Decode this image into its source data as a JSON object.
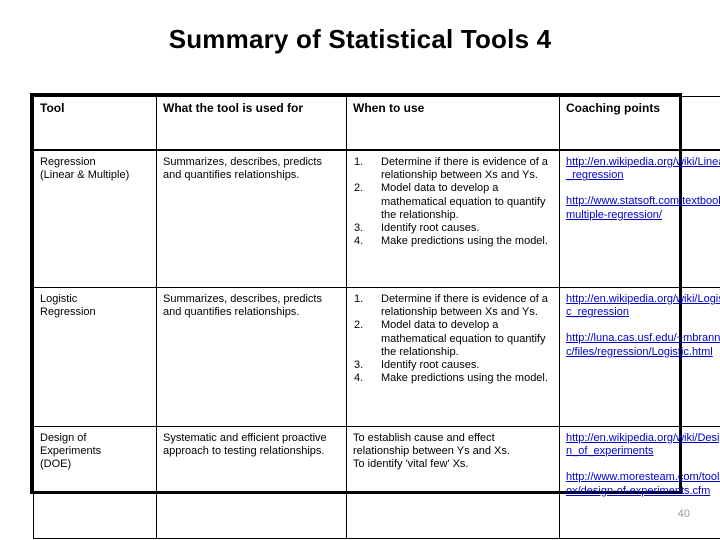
{
  "slide": {
    "title": "Summary of Statistical Tools 4",
    "page_number": "40",
    "link_color": "#0000CC",
    "text_color": "#000000",
    "page_number_color": "#9a9a9a"
  },
  "table": {
    "headers": [
      "Tool",
      "What the tool is used for",
      "When to use",
      "Coaching points"
    ],
    "rows": [
      {
        "tool": "Regression\n(Linear & Multiple)",
        "used_for": "Summarizes, describes, predicts and quantifies relationships.",
        "when_to_use": [
          "Determine if there is evidence of a relationship between Xs and Ys.",
          "Model data to develop a mathematical equation to quantify the relationship.",
          "Identify root causes.",
          "Make predictions using the model."
        ],
        "coaching_links": [
          "http://en.wikipedia.org/wiki/Linear_regression",
          "http://www.statsoft.com/textbook/multiple-regression/"
        ]
      },
      {
        "tool": "Logistic\nRegression",
        "used_for": "Summarizes, describes, predicts and quantifies relationships.",
        "when_to_use": [
          "Determine if there is evidence of a relationship between Xs and Ys.",
          "Model data to develop a mathematical equation to quantify the relationship.",
          "Identify root causes.",
          "Make predictions using the model."
        ],
        "coaching_links": [
          "http://en.wikipedia.org/wiki/Logistic_regression",
          "http://luna.cas.usf.edu/~mbrannic/files/regression/Logistic.html"
        ]
      },
      {
        "tool": "Design of\nExperiments\n(DOE)",
        "used_for": "Systematic and efficient proactive approach to testing relationships.",
        "when_to_use_text": "To establish cause and effect relationship between Ys and Xs.\nTo identify 'vital few' Xs.",
        "coaching_links": [
          "http://en.wikipedia.org/wiki/Design_of_experiments",
          "http://www.moresteam.com/toolbox/design-of-experiments.cfm"
        ]
      }
    ]
  }
}
